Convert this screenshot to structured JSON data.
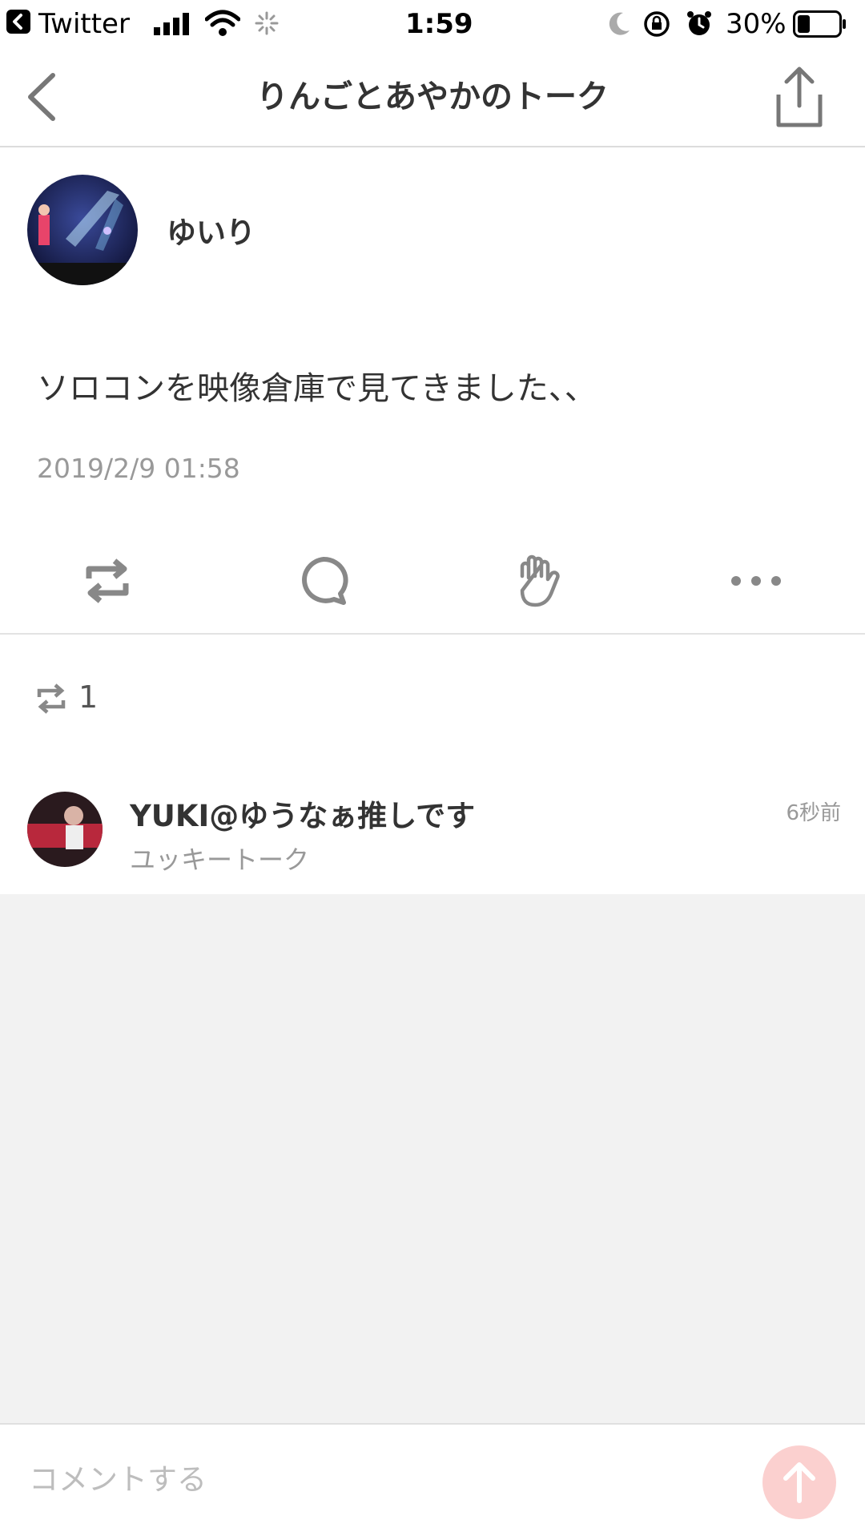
{
  "status_bar": {
    "back_app": "Twitter",
    "time": "1:59",
    "battery": "30%",
    "battery_level": 0.3
  },
  "nav": {
    "title": "りんごとあやかのトーク"
  },
  "post": {
    "author": "ゆいり",
    "body": "ソロコンを映像倉庫で見てきました、、",
    "timestamp": "2019/2/9 01:58"
  },
  "repost_count": "1",
  "reposter": {
    "name": "YUKI@ゆうなぁ推しです",
    "group": "ユッキートーク",
    "time": "6秒前"
  },
  "comment": {
    "placeholder": "コメントする"
  },
  "colors": {
    "send_button": "#fbd0cf",
    "icon_gray": "#8c8c8c"
  }
}
